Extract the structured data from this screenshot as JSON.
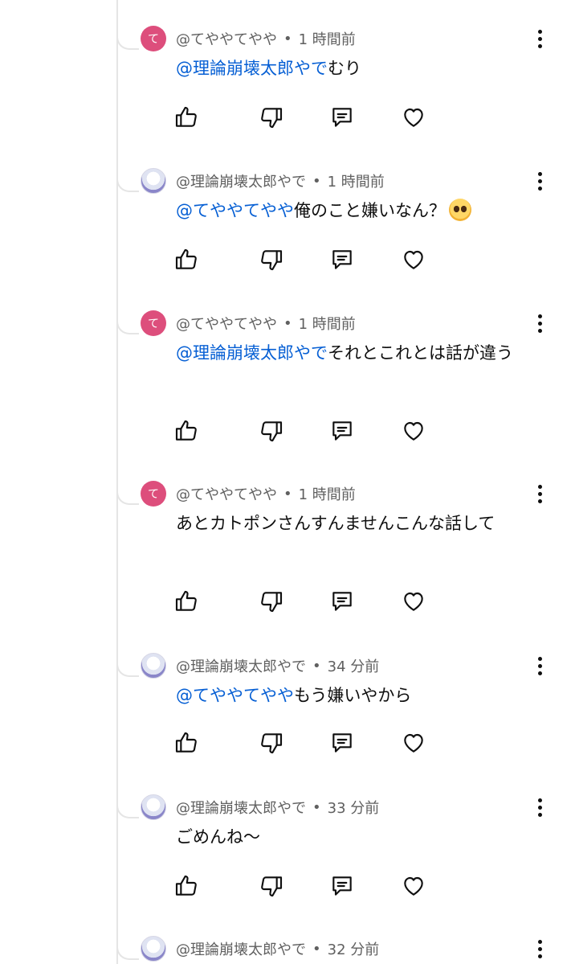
{
  "replies": [
    {
      "author": "@てややてやや",
      "time": "1 時間前",
      "mention": "@理論崩壊太郎やで",
      "text": "むり",
      "avatar_style": "pink",
      "avatar_text": "て"
    },
    {
      "author": "@理論崩壊太郎やで",
      "time": "1 時間前",
      "mention": "@てややてやや",
      "text": "俺のこと嫌いなん？",
      "emoji": "pleading-face-emoji",
      "avatar_style": "picture",
      "avatar_text": ""
    },
    {
      "author": "@てややてやや",
      "time": "1 時間前",
      "mention": "@理論崩壊太郎やで",
      "text": "それとこれとは話が違う",
      "avatar_style": "pink",
      "avatar_text": "て"
    },
    {
      "author": "@てややてやや",
      "time": "1 時間前",
      "mention": "",
      "text": "あとカトポンさんすんませんこんな話して",
      "avatar_style": "pink",
      "avatar_text": "て"
    },
    {
      "author": "@理論崩壊太郎やで",
      "time": "34 分前",
      "mention": "@てややてやや",
      "text": "もう嫌いやから",
      "avatar_style": "picture",
      "avatar_text": ""
    },
    {
      "author": "@理論崩壊太郎やで",
      "time": "33 分前",
      "mention": "",
      "text": "ごめんね～",
      "avatar_style": "picture",
      "avatar_text": ""
    },
    {
      "author": "@理論崩壊太郎やで",
      "time": "32 分前",
      "mention": "",
      "text": "",
      "avatar_style": "picture",
      "avatar_text": ""
    }
  ],
  "meta_separator": "•",
  "icons": {
    "like": "thumbs-up-icon",
    "dislike": "thumbs-down-icon",
    "reply": "reply-comment-icon",
    "heart": "heart-icon",
    "menu": "more-vert-icon"
  },
  "colors": {
    "mention": "#065fd4",
    "meta": "#606060",
    "avatar_pink": "#dd4e7c",
    "thread_line": "#e5e5e5"
  }
}
